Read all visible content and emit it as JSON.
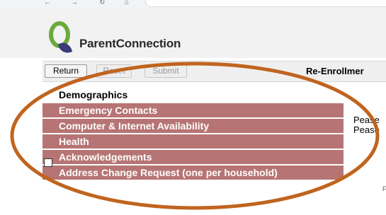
{
  "header": {
    "app_name": "ParentConnection",
    "logo_icon": "q-leaf-logo",
    "logo_colors": {
      "ring": "#6aaa3a",
      "leaf": "#3c3a7a"
    }
  },
  "toolbar": {
    "return_label": "Return",
    "reset_label": "Reset",
    "submit_label": "Submit",
    "title": "Re-Enrollmer"
  },
  "menu": {
    "items": [
      {
        "label": "Demographics"
      },
      {
        "label": "Emergency Contacts"
      },
      {
        "label": "Computer & Internet Availability"
      },
      {
        "label": "Health"
      },
      {
        "label": "Acknowledgements"
      },
      {
        "label": "Address Change Request (one per household)"
      }
    ],
    "item_color": "#b77474"
  },
  "side": {
    "line1": "Pease",
    "line2": "Pease",
    "mark": "F"
  },
  "annotation": {
    "ellipse_color": "#c0641f"
  }
}
